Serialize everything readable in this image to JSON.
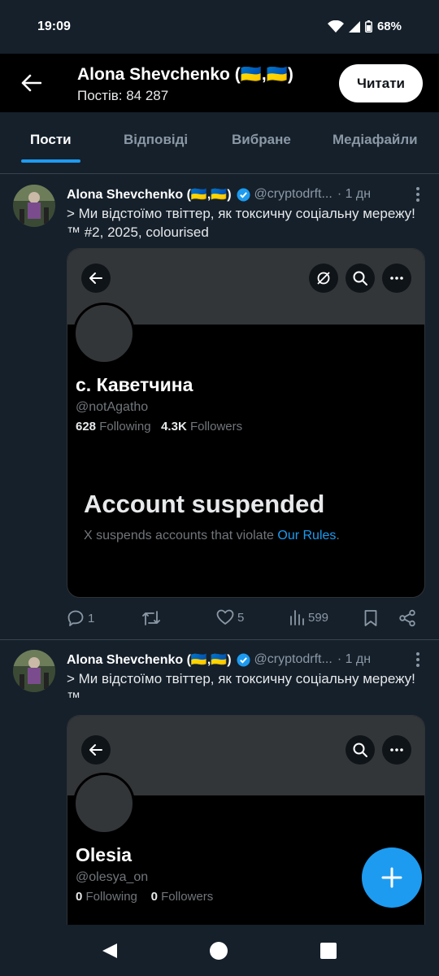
{
  "status_bar": {
    "time": "19:09",
    "battery": "68%"
  },
  "header": {
    "title": "Alona Shevchenko (🇺🇦,🇺🇦)",
    "subtitle": "Постів: 84 287",
    "follow_label": "Читати"
  },
  "tabs": [
    {
      "label": "Пости",
      "active": true
    },
    {
      "label": "Відповіді",
      "active": false
    },
    {
      "label": "Вибране",
      "active": false
    },
    {
      "label": "Медіафайли",
      "active": false
    }
  ],
  "tweets": [
    {
      "name": "Alona Shevchenko (🇺🇦,🇺🇦)",
      "handle": "@cryptodrft...",
      "time": "· 1 дн",
      "text": "> Ми відстоїмо твіттер, як токсичну соціальну мережу!™  #2, 2025, colourised",
      "card": {
        "name": "с. Каветчина",
        "handle": "@notAgatho",
        "following_count": "628",
        "following_label": "Following",
        "followers_count": "4.3K",
        "followers_label": "Followers",
        "suspended_title": "Account suspended",
        "suspended_text": "X suspends accounts that violate",
        "suspended_link": "Our Rules",
        "suspended_end": "."
      },
      "replies": "1",
      "likes": "5",
      "views": "599"
    },
    {
      "name": "Alona Shevchenko (🇺🇦,🇺🇦)",
      "handle": "@cryptodrft...",
      "time": "· 1 дн",
      "text": "> Ми відстоїмо твіттер, як токсичну соціальну мережу!™",
      "card": {
        "name": "Olesia",
        "handle": "@olesya_on",
        "following_count": "0",
        "following_label": "Following",
        "followers_count": "0",
        "followers_label": "Followers"
      }
    }
  ],
  "colors": {
    "accent": "#1d9bf0",
    "background": "#15202b",
    "verified": "#1d9bf0"
  },
  "icons": {
    "fab": "plus-icon",
    "nav": [
      "back-triangle-icon",
      "home-circle-icon",
      "recents-square-icon"
    ]
  }
}
